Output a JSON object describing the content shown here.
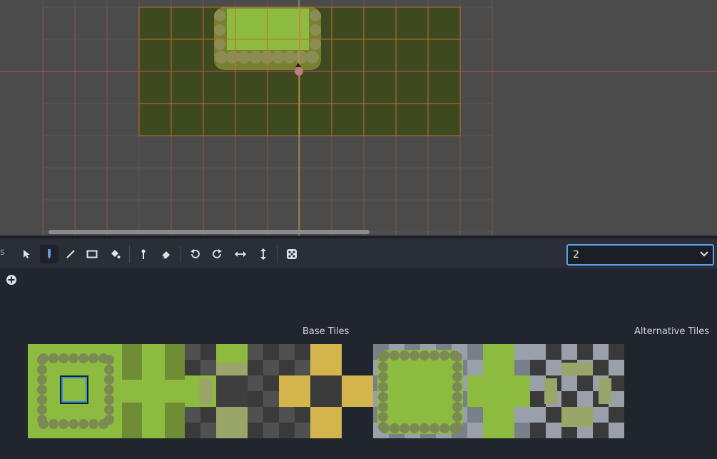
{
  "viewport": {
    "grid_color": "#c86b2f",
    "axis_x_color": "#c7486e",
    "axis_y_color": "#b5a55c",
    "map_color": "#3d4a1f",
    "background": "#4b4b4b"
  },
  "toolbar": {
    "cut_label": "s",
    "tools": [
      {
        "name": "select-icon",
        "active": false
      },
      {
        "name": "paint-icon",
        "active": true
      },
      {
        "name": "line-icon",
        "active": false
      },
      {
        "name": "rect-icon",
        "active": false
      },
      {
        "name": "bucket-icon",
        "active": false
      },
      {
        "name": "picker-icon",
        "active": false
      },
      {
        "name": "eraser-icon",
        "active": false
      },
      {
        "name": "rotate-left-icon",
        "active": false
      },
      {
        "name": "rotate-right-icon",
        "active": false
      },
      {
        "name": "flip-h-icon",
        "active": false
      },
      {
        "name": "flip-v-icon",
        "active": false
      },
      {
        "name": "random-icon",
        "active": false
      }
    ],
    "scatter_value": "2"
  },
  "panel": {
    "base_tiles_label": "Base Tiles",
    "alternative_tiles_label": "Alternative Tiles"
  },
  "colors": {
    "accent": "#5ba3e8",
    "grass": "#8dbb3f",
    "grass_dark": "#6f8d34",
    "bush": "#7a8a52",
    "path": "#d4b54b",
    "checker_a": "#3a3a3a",
    "checker_b": "#505050"
  }
}
